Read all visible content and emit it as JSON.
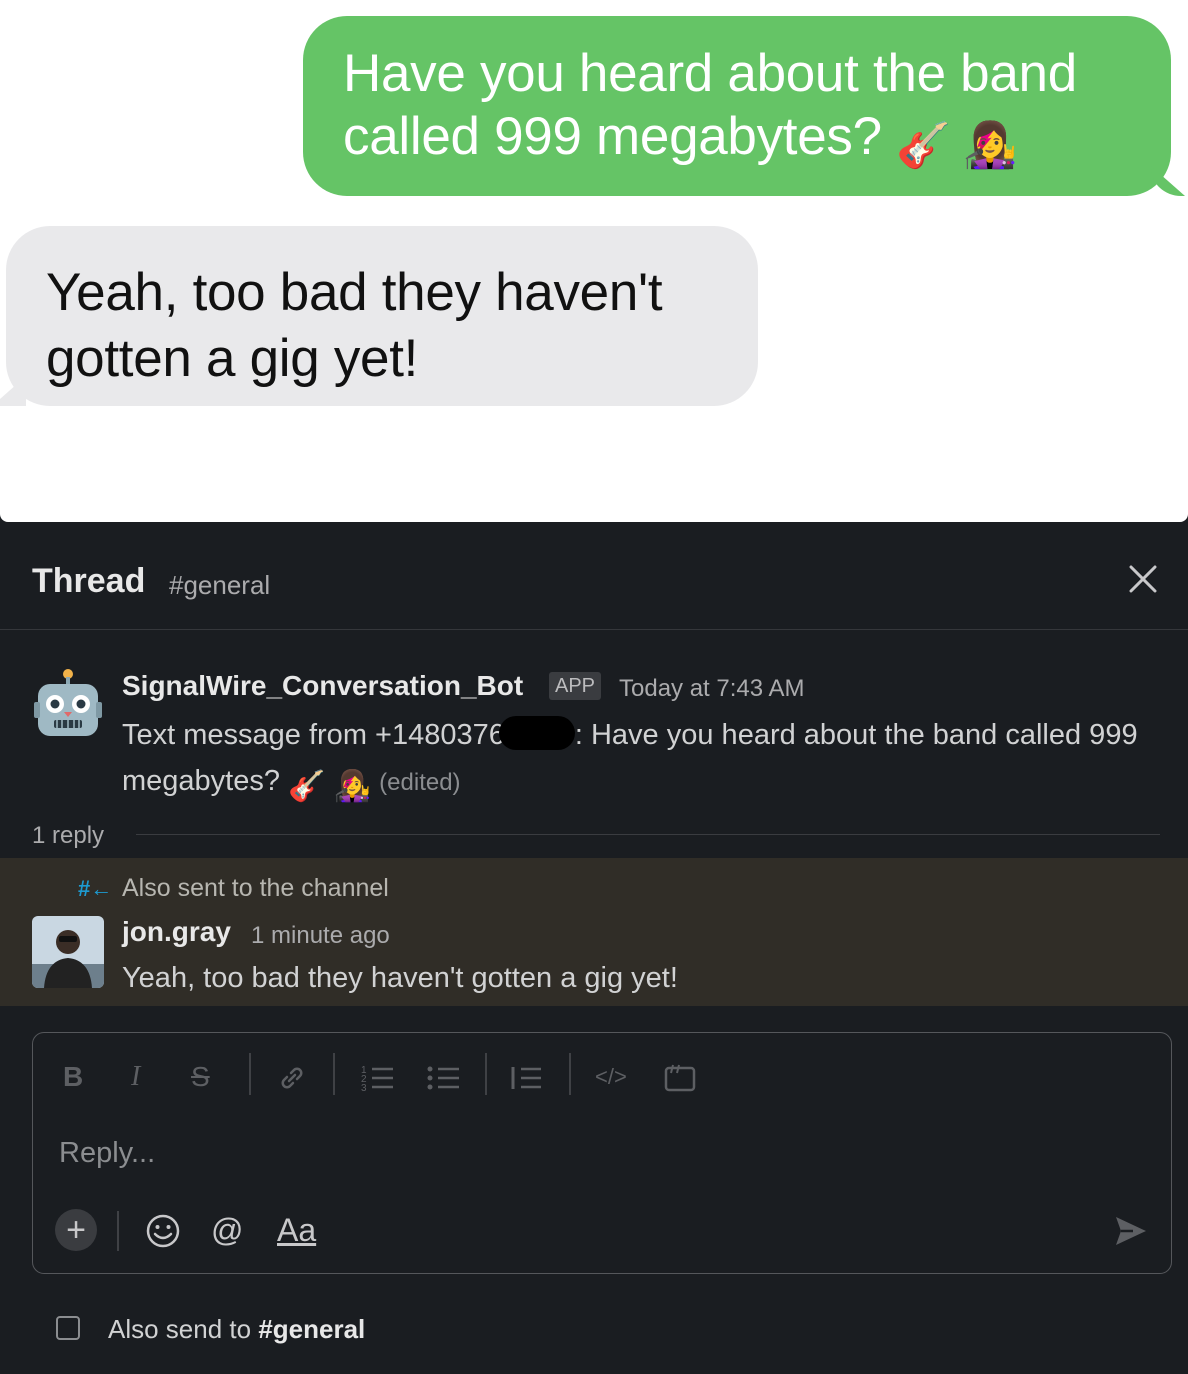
{
  "imessage": {
    "outgoing_text": "Have you heard about the band called 999 megabytes?",
    "outgoing_emoji": "🎸 👩‍🎤",
    "incoming_text": "Yeah, too bad they haven't gotten a gig yet!"
  },
  "thread": {
    "title": "Thread",
    "channel": "#general",
    "close_icon": "close-icon",
    "bot_message": {
      "sender": "SignalWire_Conversation_Bot",
      "badge": "APP",
      "time": "Today at 7:43 AM",
      "text_prefix": "Text message from +1480376",
      "text_suffix": ": Have you heard about the band called 999 megabytes?",
      "emoji": "🎸 👩‍🎤",
      "edited_label": "(edited)"
    },
    "reply_count": "1 reply",
    "reply": {
      "also_sent_label": "Also sent to the channel",
      "sender": "jon.gray",
      "time": "1 minute ago",
      "text": "Yeah, too bad they haven't gotten a gig yet!"
    },
    "composer": {
      "placeholder": "Reply...",
      "format_label": "Aa",
      "also_send_prefix": "Also send to ",
      "also_send_channel": "#general"
    }
  }
}
